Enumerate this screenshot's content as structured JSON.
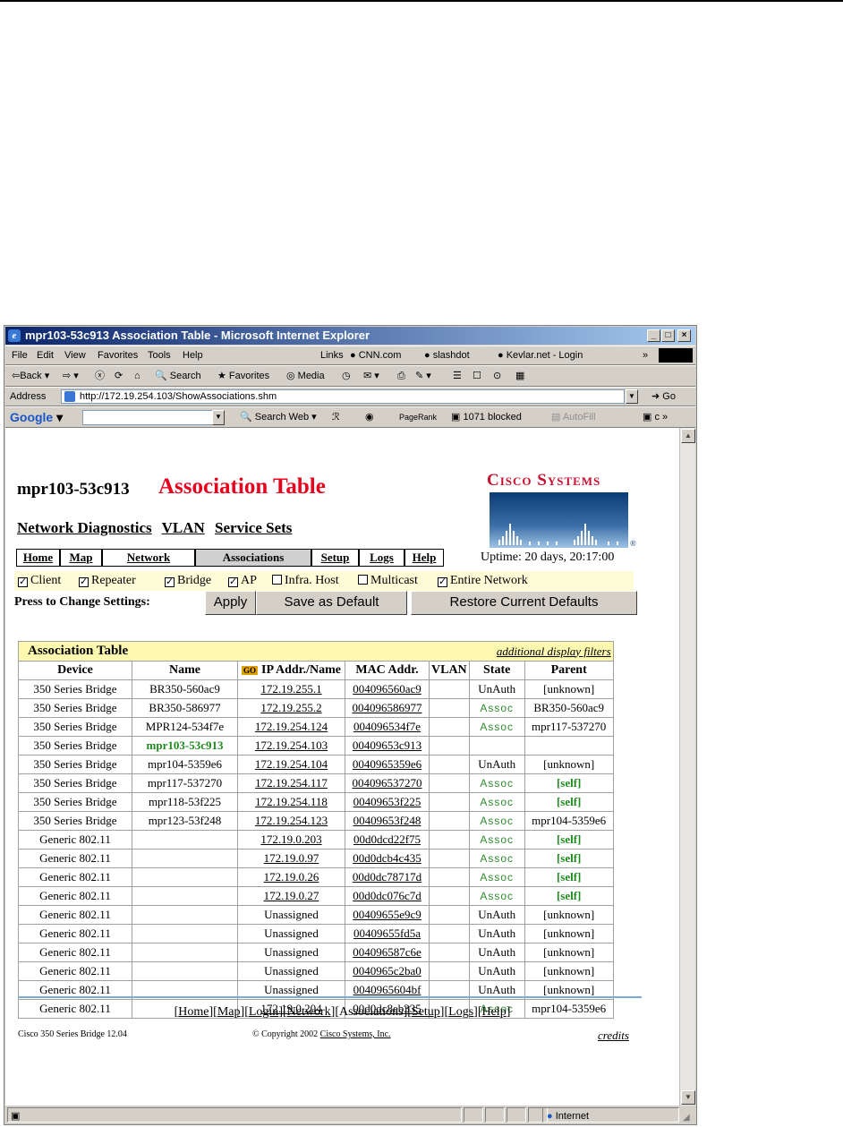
{
  "window": {
    "title": "mpr103-53c913 Association Table - Microsoft Internet Explorer",
    "min": "_",
    "max": "□",
    "close": "×"
  },
  "menu": {
    "items": [
      "File",
      "Edit",
      "View",
      "Favorites",
      "Tools",
      "Help"
    ],
    "links_label": "Links",
    "links": [
      "CNN.com",
      "slashdot",
      "Kevlar.net - Login"
    ],
    "chevron": "»"
  },
  "toolbar": {
    "back": "⇦Back ▾",
    "forward": "⇨ ▾",
    "stop": "ⓧ",
    "refresh": "⟳",
    "home": "⌂",
    "search": "Search",
    "favorites": "Favorites",
    "media": "Media"
  },
  "address": {
    "label": "Address",
    "url": "http://172.19.254.103/ShowAssociations.shm",
    "go": "Go"
  },
  "google": {
    "logo": "Google",
    "search_web": "Search Web",
    "pagerank": "PageRank",
    "blocked": "1071 blocked",
    "autofill": "AutoFill"
  },
  "page": {
    "hostname": "mpr103-53c913",
    "title": "Association Table",
    "brand": "Cisco Systems",
    "navlinks": [
      "Network Diagnostics",
      "VLAN",
      "Service Sets"
    ],
    "tabs": [
      "Home",
      "Map",
      "Network",
      "Associations",
      "Setup",
      "Logs",
      "Help"
    ],
    "uptime": "Uptime: 20 days, 20:17:00",
    "filters": [
      "Client",
      "Repeater",
      "Bridge",
      "AP",
      "Infra. Host",
      "Multicast",
      "Entire Network"
    ],
    "filters_checked": [
      true,
      true,
      true,
      true,
      false,
      false,
      true
    ],
    "press_label": "Press to Change Settings:",
    "buttons": {
      "apply": "Apply",
      "save": "Save as Default",
      "restore": "Restore Current Defaults"
    },
    "table_title": "Association Table",
    "table_filters": "additional display filters",
    "columns": [
      "Device",
      "Name",
      "IP Addr./Name",
      "MAC Addr.",
      "VLAN",
      "State",
      "Parent"
    ],
    "rows": [
      [
        "350 Series Bridge",
        "BR350-560ac9",
        "172.19.255.1",
        "004096560ac9",
        "",
        "UnAuth",
        "[unknown]"
      ],
      [
        "350 Series Bridge",
        "BR350-586977",
        "172.19.255.2",
        "004096586977",
        "",
        "Assoc",
        "BR350-560ac9"
      ],
      [
        "350 Series Bridge",
        "MPR124-534f7e",
        "172.19.254.124",
        "004096534f7e",
        "",
        "Assoc",
        "mpr117-537270"
      ],
      [
        "350 Series Bridge",
        "mpr103-53c913",
        "172.19.254.103",
        "00409653c913",
        "",
        "",
        ""
      ],
      [
        "350 Series Bridge",
        "mpr104-5359e6",
        "172.19.254.104",
        "0040965359e6",
        "",
        "UnAuth",
        "[unknown]"
      ],
      [
        "350 Series Bridge",
        "mpr117-537270",
        "172.19.254.117",
        "004096537270",
        "",
        "Assoc",
        "[self]"
      ],
      [
        "350 Series Bridge",
        "mpr118-53f225",
        "172.19.254.118",
        "00409653f225",
        "",
        "Assoc",
        "[self]"
      ],
      [
        "350 Series Bridge",
        "mpr123-53f248",
        "172.19.254.123",
        "00409653f248",
        "",
        "Assoc",
        "mpr104-5359e6"
      ],
      [
        "Generic 802.11",
        "",
        "172.19.0.203",
        "00d0dcd22f75",
        "",
        "Assoc",
        "[self]"
      ],
      [
        "Generic 802.11",
        "",
        "172.19.0.97",
        "00d0dcb4c435",
        "",
        "Assoc",
        "[self]"
      ],
      [
        "Generic 802.11",
        "",
        "172.19.0.26",
        "00d0dc78717d",
        "",
        "Assoc",
        "[self]"
      ],
      [
        "Generic 802.11",
        "",
        "172.19.0.27",
        "00d0dc076c7d",
        "",
        "Assoc",
        "[self]"
      ],
      [
        "Generic 802.11",
        "",
        "Unassigned",
        "00409655e9c9",
        "",
        "UnAuth",
        "[unknown]"
      ],
      [
        "Generic 802.11",
        "",
        "Unassigned",
        "00409655fd5a",
        "",
        "UnAuth",
        "[unknown]"
      ],
      [
        "Generic 802.11",
        "",
        "Unassigned",
        "004096587c6e",
        "",
        "UnAuth",
        "[unknown]"
      ],
      [
        "Generic 802.11",
        "",
        "Unassigned",
        "0040965c2ba0",
        "",
        "UnAuth",
        "[unknown]"
      ],
      [
        "Generic 802.11",
        "",
        "Unassigned",
        "0040965604bf",
        "",
        "UnAuth",
        "[unknown]"
      ],
      [
        "Generic 802.11",
        "",
        "172.19.0.204",
        "00d0dc8eb335",
        "",
        "Assoc",
        "mpr104-5359e6"
      ]
    ],
    "footer_links": [
      "Home",
      "Map",
      "Login",
      "Network",
      "Associations",
      "Setup",
      "Logs",
      "Help"
    ],
    "footer_left": "Cisco 350 Series Bridge 12.04",
    "copyright": "© Copyright 2002",
    "copyright_link": "Cisco Systems, Inc.",
    "credits": "credits"
  },
  "status": {
    "zone": "Internet"
  },
  "colors": {
    "title": "#e8001c",
    "assoc": "#2e8b2e",
    "header_bg": "#fdf8b0",
    "filter_bg": "#fdfcd6"
  }
}
